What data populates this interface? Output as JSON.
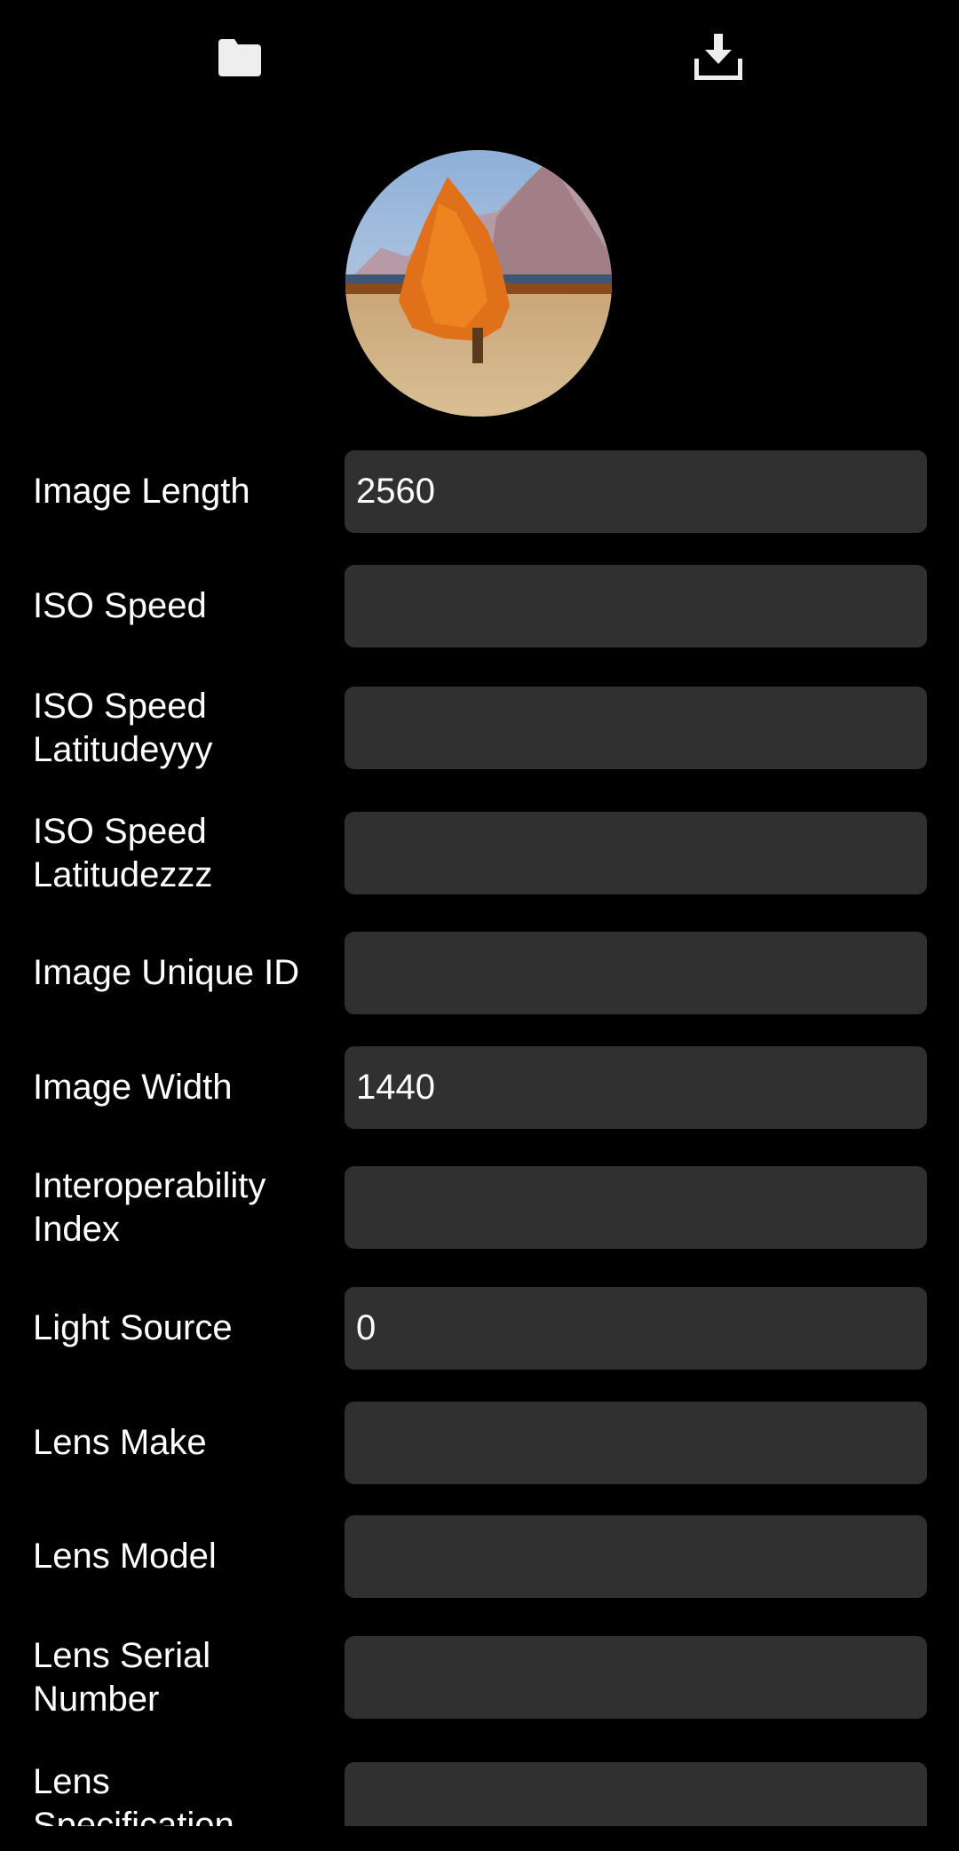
{
  "toolbar": {
    "open_icon": "folder-icon",
    "save_icon": "download-icon"
  },
  "fields": [
    {
      "label": "Image Length",
      "value": "2560"
    },
    {
      "label": "ISO Speed",
      "value": ""
    },
    {
      "label": "ISO Speed Latitudeyyy",
      "value": ""
    },
    {
      "label": "ISO Speed Latitudezzz",
      "value": ""
    },
    {
      "label": "Image Unique ID",
      "value": ""
    },
    {
      "label": "Image Width",
      "value": "1440"
    },
    {
      "label": "Interoperability Index",
      "value": ""
    },
    {
      "label": "Light Source",
      "value": "0"
    },
    {
      "label": "Lens Make",
      "value": ""
    },
    {
      "label": "Lens Model",
      "value": ""
    },
    {
      "label": "Lens Serial Number",
      "value": ""
    },
    {
      "label": "Lens Specification",
      "value": ""
    }
  ],
  "colors": {
    "background": "#000000",
    "field": "#303030",
    "text": "#ffffff"
  }
}
